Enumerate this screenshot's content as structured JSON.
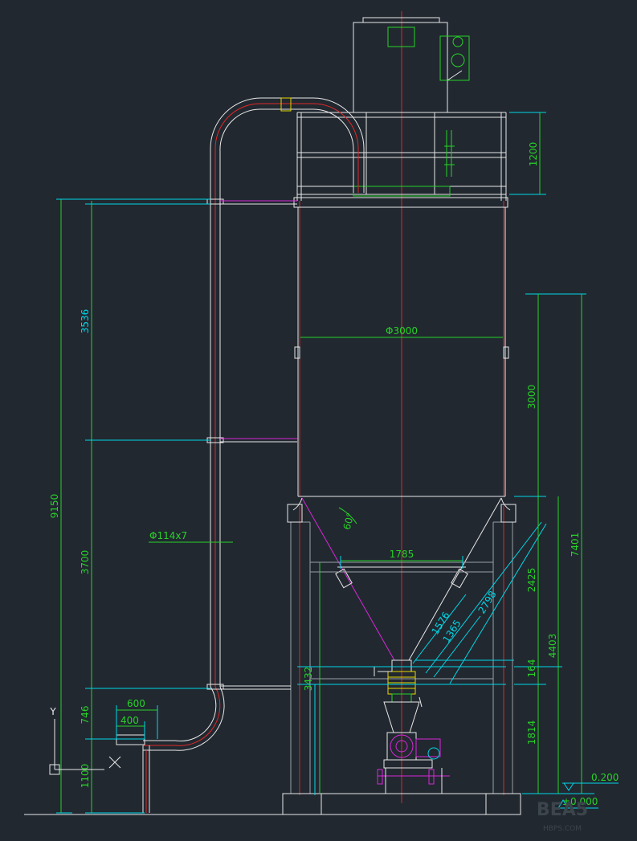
{
  "colors": {
    "background": "#212830",
    "structure": "#e8e8e8",
    "red": "#e02828",
    "green": "#27d227",
    "cyan": "#00d8e8",
    "magenta": "#d828d8",
    "yellow": "#e8d800",
    "grey": "#9aa0a6"
  },
  "dimensions": {
    "overall_height": "9150",
    "upper_segment": "3536",
    "middle_segment": "3700",
    "bend_segment": "746",
    "foot_segment": "1100",
    "pipe_spec": "Φ114x7",
    "offset_600": "600",
    "offset_400": "400",
    "tank_diameter": "Φ3000",
    "top_frame": "1200",
    "cylinder_height": "3000",
    "total_7401": "7401",
    "cone_height": "2425",
    "dim_4403": "4403",
    "dim_164": "164",
    "dim_1814": "1814",
    "dim_3432": "3432",
    "cone_opening": "1785",
    "cone_angle": "60°",
    "slant_2798": "2798",
    "slant_1576": "1576",
    "slant_1365": "1365",
    "level_0200": "0.200",
    "level_0000": "±0.000"
  },
  "axes": {
    "y_label": "Y",
    "x_label": "X"
  },
  "watermark": {
    "main": "BEA5",
    "sub": "HBPS.COM"
  }
}
